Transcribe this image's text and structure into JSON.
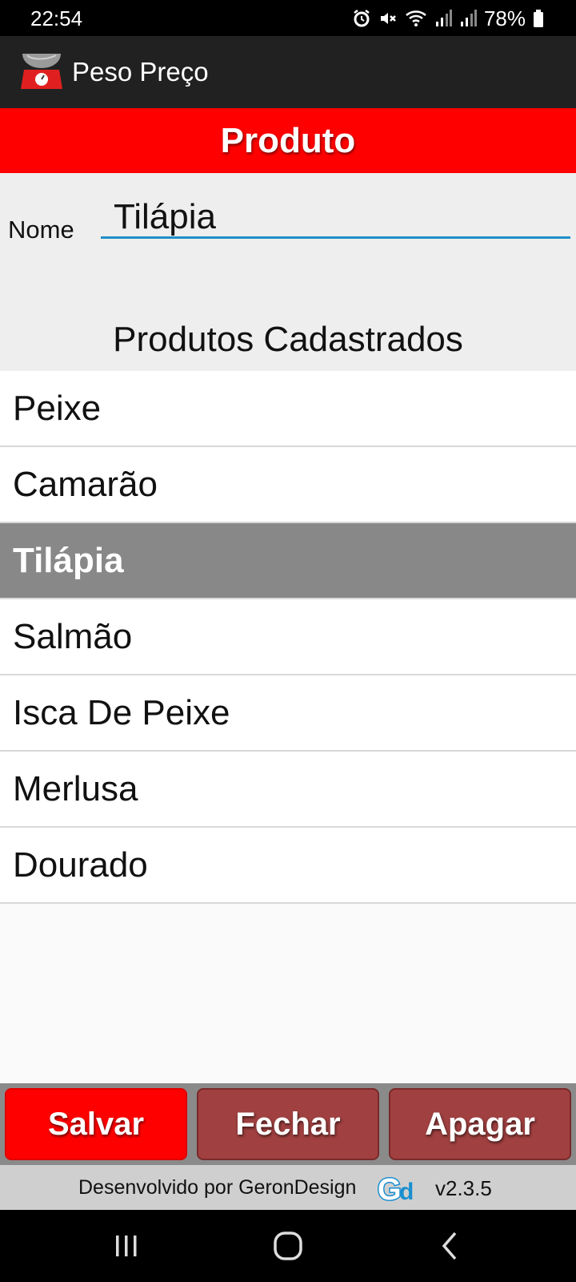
{
  "status_bar": {
    "time": "22:54",
    "battery": "78%",
    "icons": [
      "alarm-icon",
      "mute-icon",
      "wifi-icon",
      "signal-icon",
      "signal-icon",
      "battery-icon"
    ]
  },
  "app_bar": {
    "title": "Peso Preço",
    "logo_icon": "kitchen-scale-icon"
  },
  "header": {
    "title": "Produto"
  },
  "form": {
    "name_label": "Nome",
    "name_value": "Tilápia"
  },
  "list": {
    "title": "Produtos Cadastrados",
    "items": [
      {
        "label": "Peixe",
        "selected": false
      },
      {
        "label": "Camarão",
        "selected": false
      },
      {
        "label": "Tilápia",
        "selected": true
      },
      {
        "label": "Salmão",
        "selected": false
      },
      {
        "label": "Isca De Peixe",
        "selected": false
      },
      {
        "label": "Merlusa",
        "selected": false
      },
      {
        "label": "Dourado",
        "selected": false
      }
    ]
  },
  "buttons": {
    "save": "Salvar",
    "close": "Fechar",
    "delete": "Apagar"
  },
  "footer": {
    "text": "Desenvolvido por GeronDesign",
    "logo_text": "Gd",
    "version": "v2.3.5"
  },
  "colors": {
    "header_red": "#ff0000",
    "button_dark_red": "#a04040",
    "selected_gray": "#888888",
    "input_underline": "#1e90c8",
    "app_bar": "#212121"
  }
}
